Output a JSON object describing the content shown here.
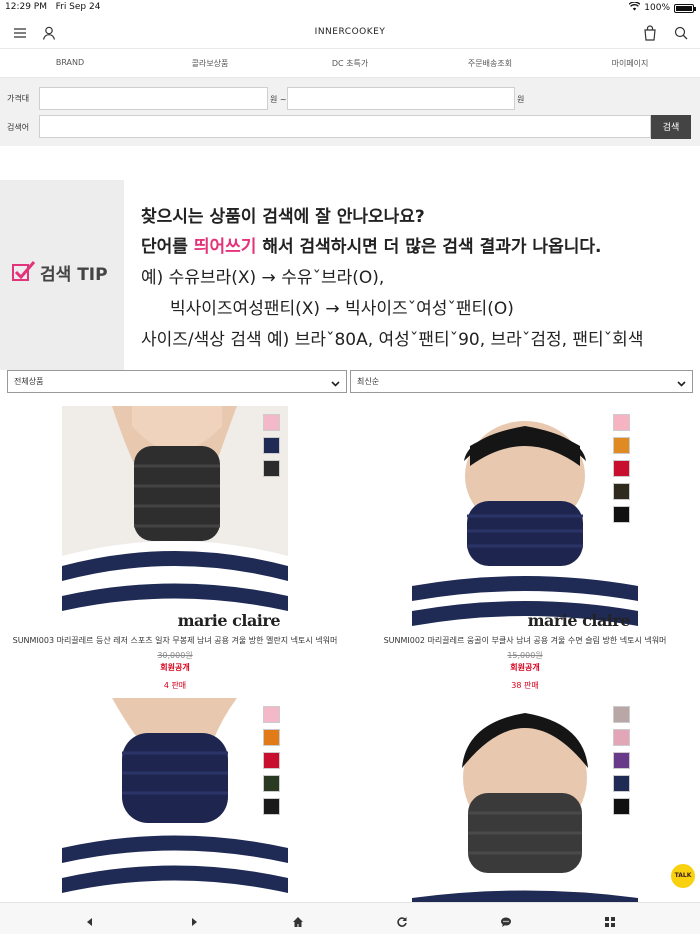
{
  "status_bar": {
    "time": "12:29 PM",
    "date": "Fri Sep 24",
    "battery": "100%"
  },
  "header": {
    "logo": "INNERCOOKEY"
  },
  "nav": {
    "items": [
      "BRAND",
      "콜라보상품",
      "DC 초특가",
      "주문배송조회",
      "마이페이지"
    ]
  },
  "search": {
    "price_label": "가격대",
    "unit_from": "원 ~",
    "unit_to": "원",
    "keyword_label": "검색어",
    "button": "검색",
    "price_min_value": "",
    "price_max_value": "",
    "keyword_value": ""
  },
  "tip": {
    "title": "검색 TIP",
    "line1": "찾으시는 상품이 검색에 잘 안나오나요?",
    "line2_pre": "단어를 ",
    "line2_pink": "띄어쓰기",
    "line2_post": " 해서 검색하시면 더 많은 검색 결과가 나옵니다.",
    "line3": "예) 수유브라(X) → 수유ˇ브라(O),",
    "line4": "빅사이즈여성팬티(X) → 빅사이즈ˇ여성ˇ팬티(O)",
    "line5": "사이즈/색상 검색 예) 브라ˇ80A, 여성ˇ팬티ˇ90, 브라ˇ검정, 팬티ˇ회색"
  },
  "filters": {
    "category": "전체상품",
    "sort": "최신순"
  },
  "products": [
    {
      "name": "SUNMI003 마리끌레르 등산 레저 스포츠 일자 무봉제 남녀 공용 겨울 방한 멜란지 넥토시 넥워머",
      "price": "30,000원",
      "member": "회원공개",
      "sold": "4 판매",
      "brand": "marie claire",
      "swatches": [
        "#f4b9c8",
        "#1f2a55",
        "#2b2b2b"
      ]
    },
    {
      "name": "SUNMI002 마리끌레르 웅골이 부클사 남녀 공용 겨울 수면 슬림 방한 넥토시 넥워머",
      "price": "15,000원",
      "member": "회원공개",
      "sold": "38 판매",
      "brand": "marie claire",
      "swatches": [
        "#f6b3c2",
        "#e08a24",
        "#c8102e",
        "#2f2a1e",
        "#111111"
      ]
    },
    {
      "name": "",
      "price": "",
      "member": "",
      "sold": "",
      "brand": "",
      "swatches": [
        "#f4b9c8",
        "#e07b18",
        "#c8102e",
        "#2a3a22",
        "#1a1a1a"
      ]
    },
    {
      "name": "",
      "price": "",
      "member": "",
      "sold": "",
      "brand": "",
      "swatches": [
        "#b9a6a6",
        "#e3a6b8",
        "#6a3a8a",
        "#1f2a55",
        "#111111"
      ]
    }
  ],
  "kakao": {
    "label": "TALK"
  },
  "colors": {
    "accent_pink": "#e3337a",
    "sale_red": "#d6001c",
    "button_dark": "#444444",
    "kakao_yellow": "#f9d10e"
  }
}
